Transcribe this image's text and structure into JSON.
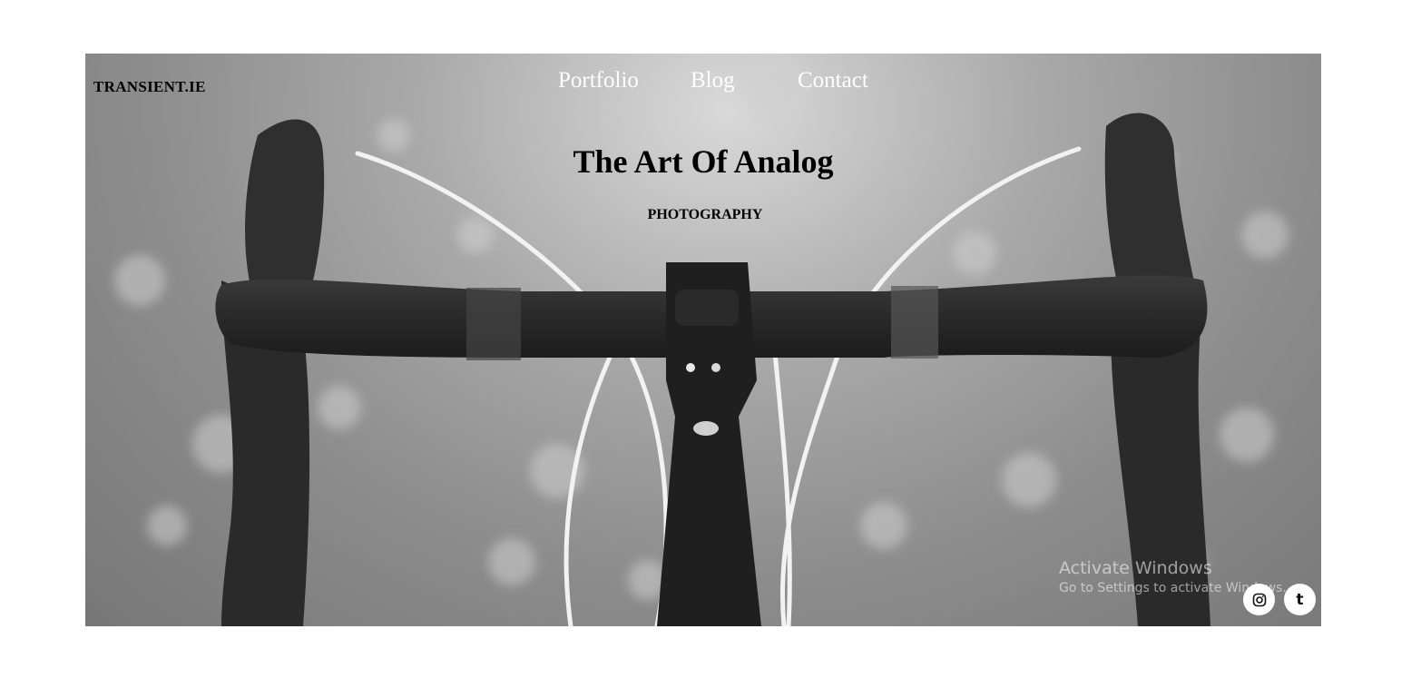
{
  "brand": {
    "logo_text": "TRANSIENT.IE"
  },
  "nav": {
    "items": [
      {
        "label": "Portfolio"
      },
      {
        "label": "Blog"
      },
      {
        "label": "Contact"
      }
    ]
  },
  "hero": {
    "title": "The Art Of Analog",
    "subtitle": "PHOTOGRAPHY",
    "image_subject": "black-and-white photo of bicycle handlebars"
  },
  "watermark": {
    "line1": "Activate Windows",
    "line2": "Go to Settings to activate Windows."
  },
  "social": {
    "icons": [
      "instagram-icon",
      "tumblr-icon"
    ],
    "tumblr_glyph": "t"
  },
  "colors": {
    "nav_text": "#ffffff",
    "heading_text": "#000000",
    "page_bg": "#ffffff"
  }
}
